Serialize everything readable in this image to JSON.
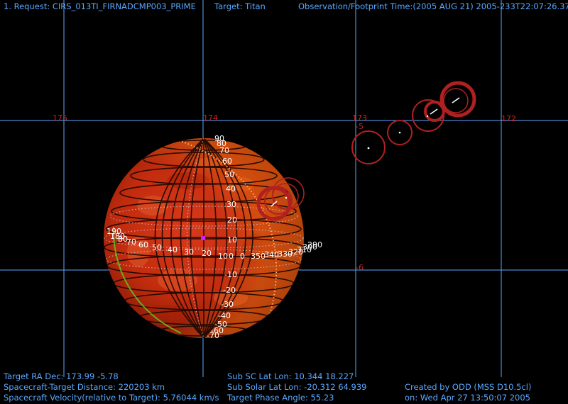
{
  "header": {
    "request": "1. Request: CIRS_013TI_FIRNADCMP003_PRIME",
    "target": "Target: Titan",
    "obs_time": "Observation/Footprint Time:(2005 AUG 21) 2005-233T22:07:26.37"
  },
  "grid": {
    "ra_labels": [
      "175",
      "174",
      "173",
      "172"
    ],
    "dec_labels": [
      "-5",
      "-6"
    ]
  },
  "globe": {
    "lat_labels": [
      "90",
      "80",
      "70",
      "60",
      "50",
      "40",
      "30",
      "20",
      "10",
      "0",
      "-10",
      "-20",
      "-30",
      "-40",
      "-50",
      "-60",
      "-70"
    ],
    "lon_labels": [
      "190",
      "180",
      "80",
      "70",
      "60",
      "50",
      "40",
      "30",
      "20",
      "10",
      "0",
      "350",
      "340",
      "330",
      "320",
      "310",
      "300",
      "290"
    ]
  },
  "info": {
    "ra_dec": "Target RA Dec: 173.99  -5.78",
    "distance": "Spacecraft-Target Distance:  220203 km",
    "velocity": "Spacecraft Velocity(relative to Target): 5.76044 km/s",
    "sub_sc": "Sub SC Lat Lon: 10.344  18.227",
    "sub_solar": "Sub Solar Lat Lon: -20.312  64.939",
    "phase": "Target Phase Angle: 55.23",
    "created_by": "Created by ODD (MSS D10.5cl)",
    "created_on": "on: Wed Apr 27 13:50:07 2005"
  },
  "colors": {
    "grid_line": "#5aa8ff",
    "grid_label": "#cc2222",
    "globe_fill": "#c83010",
    "footprint": "#b02020",
    "text": "#5aa8ff",
    "subsc_marker": "#cc22ff"
  }
}
